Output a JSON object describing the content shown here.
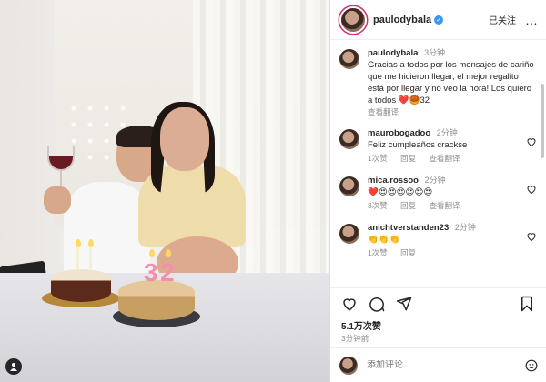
{
  "header": {
    "username": "paulodybala",
    "follow_label": "已关注",
    "more_label": "…"
  },
  "caption": {
    "username": "paulodybala",
    "time": "3分钟",
    "text": "Gracias a todos por los mensajes de cariño que me hicieron llegar, el mejor regalito está por llegar y no veo la hora! Los quiero a todos ❤️🥮32",
    "translate_label": "查看翻译"
  },
  "comments": [
    {
      "username": "maurobogadoo",
      "time": "2分钟",
      "text": "Feliz cumpleaños crackse",
      "likes": "1次赞",
      "reply": "回复",
      "translate": "查看翻译"
    },
    {
      "username": "mica.rossoo",
      "time": "2分钟",
      "text": "❤️😍😍😍😍😍😍",
      "likes": "3次赞",
      "reply": "回复",
      "translate": "查看翻译"
    },
    {
      "username": "anichtverstanden23",
      "time": "2分钟",
      "text": "👏👏👏",
      "likes": "1次赞",
      "reply": "回复"
    }
  ],
  "post": {
    "likes": "5.1万次赞",
    "time": "3分钟前"
  },
  "add_comment": {
    "placeholder": "添加评论..."
  },
  "photo": {
    "candle_digits": [
      "3",
      "2"
    ]
  },
  "colors": {
    "verified": "#3897f0",
    "story_ring": "#d62976",
    "heart_red": "#ed4956"
  },
  "icons": [
    "heart-icon",
    "comment-icon",
    "share-icon",
    "bookmark-icon",
    "emoji-icon",
    "person-tag-icon"
  ]
}
